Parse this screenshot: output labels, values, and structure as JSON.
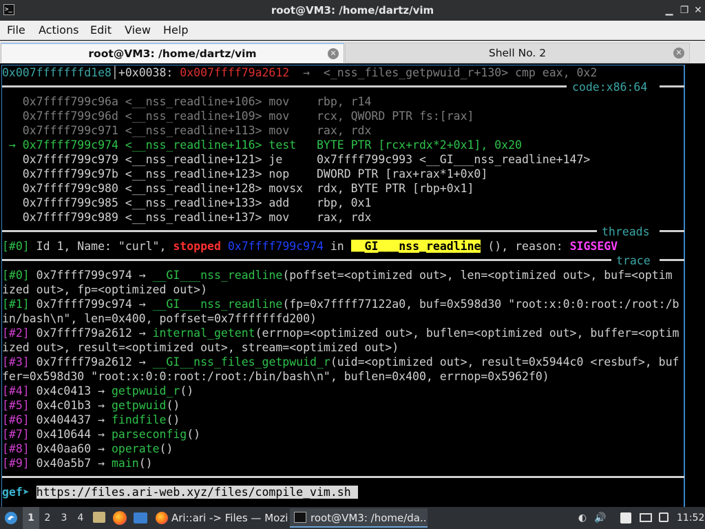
{
  "window": {
    "title": "root@VM3: /home/dartz/vim",
    "app_icon_text": ">_"
  },
  "menu": [
    "File",
    "Actions",
    "Edit",
    "View",
    "Help"
  ],
  "tabs": [
    {
      "label": "root@VM3: /home/dartz/vim",
      "active": true
    },
    {
      "label": "Shell No. 2",
      "active": false
    }
  ],
  "terminal": {
    "top_line": {
      "addr": "0x007fffffffd1e8",
      "offset": "+0x0038: ",
      "value": "0x007ffff79a2612",
      "rest": "  →  <_nss_files_getpwuid_r+130> cmp eax, 0x2"
    },
    "code_label": "code:x86:64",
    "code_lines": [
      "   0x7ffff799c96a <__nss_readline+106> mov    rbp, r14",
      "   0x7ffff799c96d <__nss_readline+109> mov    rcx, QWORD PTR fs:[rax]",
      "   0x7ffff799c971 <__nss_readline+113> mov    rax, rdx",
      " → 0x7ffff799c974 <__nss_readline+116> test   BYTE PTR [rcx+rdx*2+0x1], 0x20",
      "   0x7ffff799c979 <__nss_readline+121> je     0x7ffff799c993 <__GI___nss_readline+147>",
      "   0x7ffff799c97b <__nss_readline+123> nop    DWORD PTR [rax+rax*1+0x0]",
      "   0x7ffff799c980 <__nss_readline+128> movsx  rdx, BYTE PTR [rbp+0x1]",
      "   0x7ffff799c985 <__nss_readline+133> add    rbp, 0x1",
      "   0x7ffff799c989 <__nss_readline+137> mov    rax, rdx"
    ],
    "threads_label": "threads",
    "thread": {
      "idx": "[#0]",
      "prefix": " Id 1, Name: \"curl\", ",
      "state": "stopped",
      "addr": " 0x7ffff799c974",
      "in": " in ",
      "func": "__GI___nss_readline",
      "mid": " (), reason: ",
      "reason": "SIGSEGV"
    },
    "trace_label": "trace",
    "trace_lines": [
      {
        "idx": "[#0]",
        "text": " 0x7ffff799c974 → ",
        "func": "__GI___nss_readline",
        "args": "(poffset=<optimized out>, len=<optimized out>, buf=<optim"
      },
      {
        "idx": "",
        "text": "ized out>, fp=<optimized out>)",
        "func": "",
        "args": ""
      },
      {
        "idx": "[#1]",
        "text": " 0x7ffff799c974 → ",
        "func": "__GI___nss_readline",
        "args": "(fp=0x7ffff77122a0, buf=0x598d30 \"root:x:0:0:root:/root:/b"
      },
      {
        "idx": "",
        "text": "in/bash\\n\", len=0x400, poffset=0x7fffffffd200)",
        "func": "",
        "args": ""
      },
      {
        "idx": "[#2]",
        "text": " 0x7ffff79a2612 → ",
        "func": "internal_getent",
        "args": "(errnop=<optimized out>, buflen=<optimized out>, buffer=<optim"
      },
      {
        "idx": "",
        "text": "ized out>, result=<optimized out>, stream=<optimized out>)",
        "func": "",
        "args": ""
      },
      {
        "idx": "[#3]",
        "text": " 0x7ffff79a2612 → ",
        "func": "__GI__nss_files_getpwuid_r",
        "args": "(uid=<optimized out>, result=0x5944c0 <resbuf>, buf"
      },
      {
        "idx": "",
        "text": "fer=0x598d30 \"root:x:0:0:root:/root:/bin/bash\\n\", buflen=0x400, errnop=0x5962f0)",
        "func": "",
        "args": ""
      },
      {
        "idx": "[#4]",
        "text": " 0x4c0413 → ",
        "func": "getpwuid_r",
        "args": "()"
      },
      {
        "idx": "[#5]",
        "text": " 0x4c01b3 → ",
        "func": "getpwuid",
        "args": "()"
      },
      {
        "idx": "[#6]",
        "text": " 0x404437 → ",
        "func": "findfile",
        "args": "()"
      },
      {
        "idx": "[#7]",
        "text": " 0x410644 → ",
        "func": "parseconfig",
        "args": "()"
      },
      {
        "idx": "[#8]",
        "text": " 0x40aa60 → ",
        "func": "operate",
        "args": "()"
      },
      {
        "idx": "[#9]",
        "text": " 0x40a5b7 → ",
        "func": "main",
        "args": "()"
      }
    ],
    "prompt": "gef➤ ",
    "command": "https://files.ari-web.xyz/files/compile_vim.sh "
  },
  "taskbar": {
    "workspaces": [
      "1",
      "2",
      "3",
      "4"
    ],
    "tasks": [
      "Ari::ari -> Files — Mozi...",
      "root@VM3: /home/da..."
    ],
    "clock": "11:52"
  },
  "colors": {
    "accent": "#3a84c4",
    "green": "#2ec24a",
    "magenta": "#d040d0",
    "stopped": "#ff3030",
    "highlight": "#ffff30"
  }
}
